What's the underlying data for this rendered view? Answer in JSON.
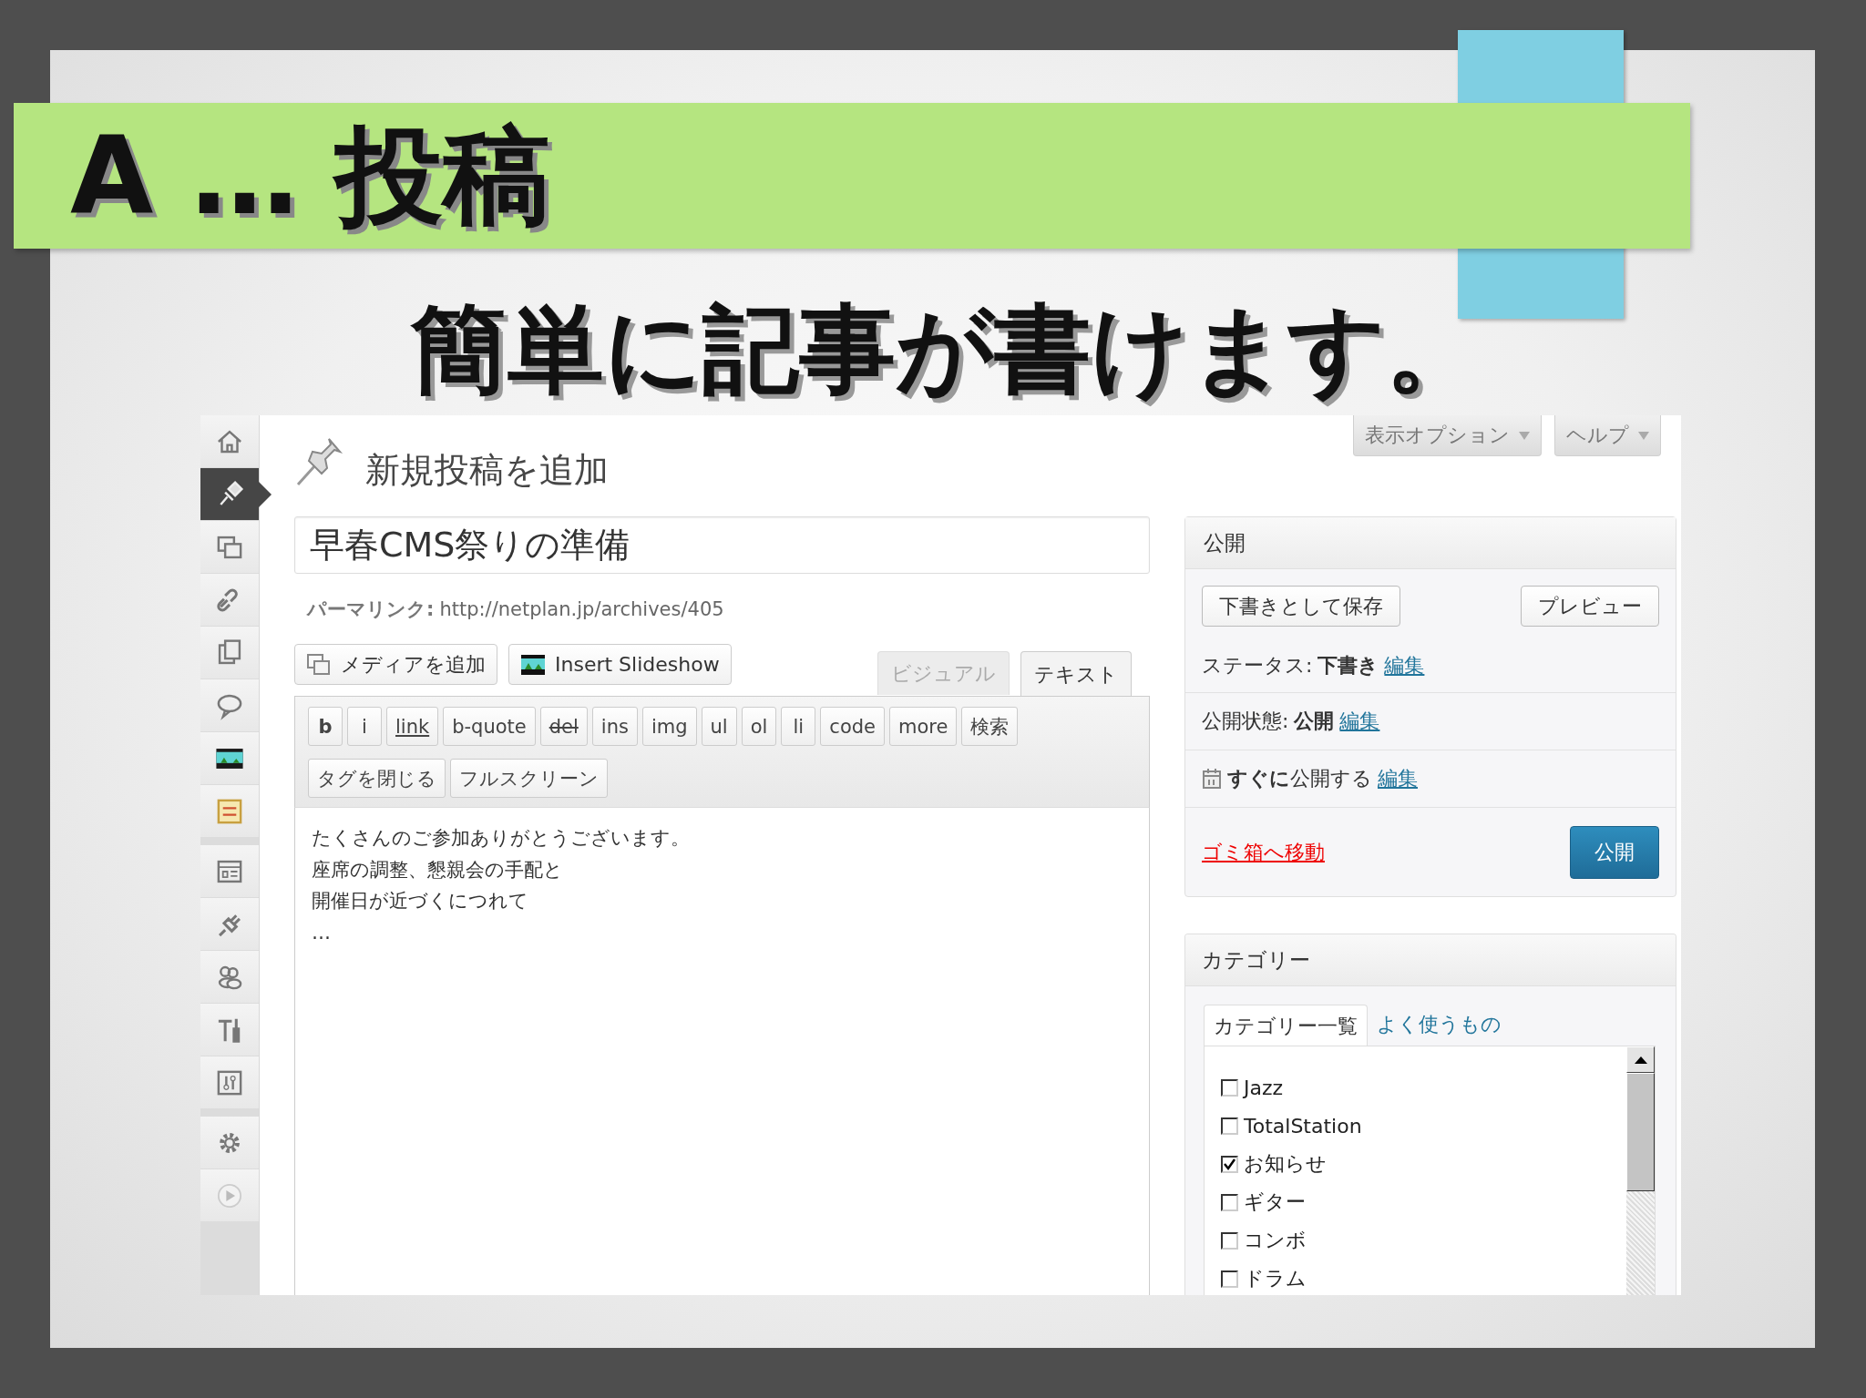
{
  "slide": {
    "heading": "A … 投稿",
    "subtitle": "簡単に記事が書けます。"
  },
  "sidebar": {
    "items": [
      {
        "selected": false
      },
      {
        "selected": true
      },
      {
        "selected": false
      },
      {
        "selected": false
      },
      {
        "selected": false
      },
      {
        "selected": false
      },
      {
        "selected": false
      },
      {
        "selected": false
      },
      {
        "selected": false
      },
      {
        "selected": false
      },
      {
        "selected": false
      },
      {
        "selected": false
      },
      {
        "selected": false
      },
      {
        "selected": false
      },
      {
        "selected": false
      }
    ]
  },
  "screen_options": [
    "表示オプション",
    "ヘルプ"
  ],
  "page_title": "新規投稿を追加",
  "post_title": "早春CMS祭りの準備",
  "permalink": {
    "label": "パーマリンク:",
    "url": "http://netplan.jp/archives/405"
  },
  "media_buttons": [
    "メディアを追加",
    "Insert Slideshow"
  ],
  "editor_tabs": [
    {
      "label": "ビジュアル",
      "selected": false
    },
    {
      "label": "テキスト",
      "selected": true
    }
  ],
  "quicktag_rows": [
    [
      {
        "label": "b",
        "kind": "bold"
      },
      {
        "label": "i",
        "kind": "plain"
      },
      {
        "label": "link",
        "kind": "link"
      },
      {
        "label": "b-quote",
        "kind": "plain"
      },
      {
        "label": "del",
        "kind": "del"
      },
      {
        "label": "ins",
        "kind": "plain"
      },
      {
        "label": "img",
        "kind": "plain"
      },
      {
        "label": "ul",
        "kind": "plain"
      },
      {
        "label": "ol",
        "kind": "plain"
      },
      {
        "label": "li",
        "kind": "plain"
      },
      {
        "label": "code",
        "kind": "plain"
      },
      {
        "label": "more",
        "kind": "plain"
      },
      {
        "label": "検索",
        "kind": "plain"
      }
    ],
    [
      {
        "label": "タグを閉じる",
        "kind": "plain"
      },
      {
        "label": "フルスクリーン",
        "kind": "plain"
      }
    ]
  ],
  "content": [
    "たくさんのご参加ありがとうございます。",
    "座席の調整、懇親会の手配と",
    "開催日が近づくにつれて",
    "…"
  ],
  "publish_box": {
    "title": "公開",
    "save_draft": "下書きとして保存",
    "preview": "プレビュー",
    "status": {
      "label": "ステータス:",
      "value": "下書き",
      "edit": "編集"
    },
    "visibility": {
      "label": "公開状態:",
      "value": "公開",
      "edit": "編集"
    },
    "schedule": {
      "value": "**すぐに**公開する",
      "edit": "編集"
    },
    "trash": "ゴミ箱へ移動",
    "publish": "公開"
  },
  "category_box": {
    "title": "カテゴリー",
    "tabs": [
      {
        "label": "カテゴリー一覧",
        "selected": true
      },
      {
        "label": "よく使うもの",
        "selected": false
      }
    ],
    "items": [
      {
        "label": "Jazz",
        "checked": false
      },
      {
        "label": "TotalStation",
        "checked": false
      },
      {
        "label": "お知らせ",
        "checked": true
      },
      {
        "label": "ギター",
        "checked": false
      },
      {
        "label": "コンボ",
        "checked": false
      },
      {
        "label": "ドラム",
        "checked": false
      }
    ]
  }
}
